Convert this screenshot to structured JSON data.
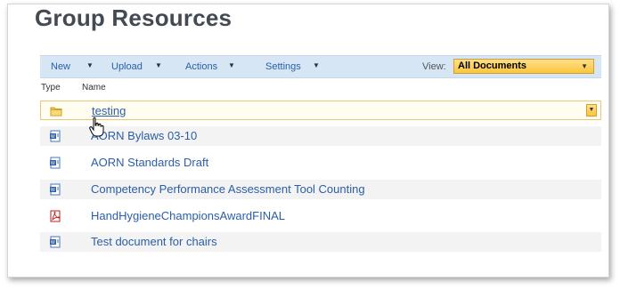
{
  "header": {
    "title": "Group Resources"
  },
  "toolbar": {
    "new_label": "New",
    "upload_label": "Upload",
    "actions_label": "Actions",
    "settings_label": "Settings",
    "view_label": "View:",
    "view_value": "All Documents"
  },
  "columns": {
    "type": "Type",
    "name": "Name"
  },
  "items": [
    {
      "name": "testing",
      "icon": "folder-icon"
    },
    {
      "name": "AORN Bylaws 03-10",
      "icon": "word-document-icon"
    },
    {
      "name": "AORN Standards Draft",
      "icon": "word-document-icon"
    },
    {
      "name": "Competency Performance Assessment Tool Counting",
      "icon": "word-document-icon"
    },
    {
      "name": "HandHygieneChampionsAwardFINAL",
      "icon": "pdf-document-icon"
    },
    {
      "name": "Test document for chairs",
      "icon": "word-document-icon"
    }
  ],
  "colors": {
    "accent": "#2a5ea8",
    "toolbar_bg": "#d6e6f5",
    "view_select": "#f9c53a"
  }
}
